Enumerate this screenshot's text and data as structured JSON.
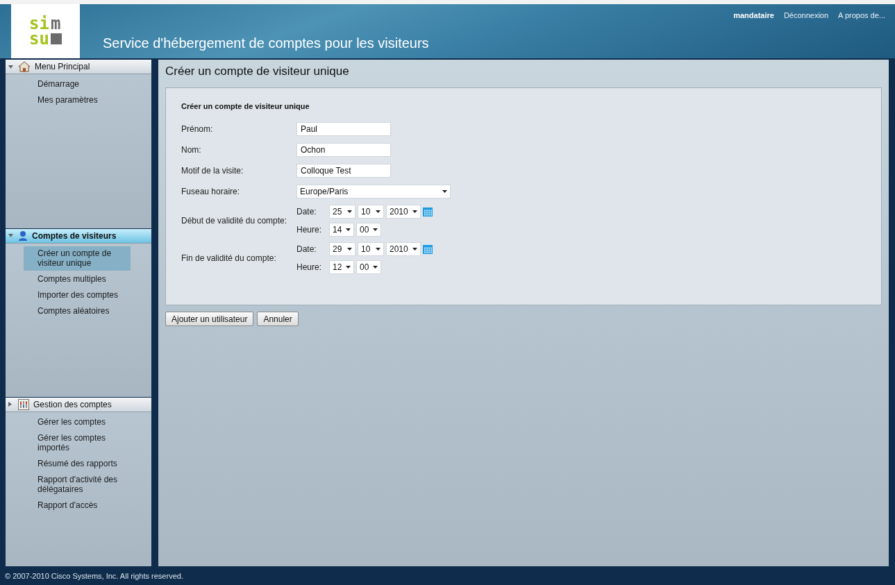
{
  "logo": {
    "parts": [
      {
        "text": "si",
        "kind": "accent"
      },
      {
        "text": "m",
        "kind": "muted"
      },
      {
        "text": "su",
        "kind": "accent"
      }
    ]
  },
  "header": {
    "title": "Service d'hébergement de comptes pour les visiteurs",
    "user": "mandataire",
    "links": [
      "Déconnexion",
      "A propos de..."
    ]
  },
  "sidebar": {
    "sections": [
      {
        "title": "Menu Principal",
        "kind": "home",
        "expanded": true,
        "selected": false,
        "items": [
          {
            "label": "Démarrage",
            "selected": false
          },
          {
            "label": "Mes paramètres",
            "selected": false
          }
        ]
      },
      {
        "title": "Comptes de visiteurs",
        "kind": "user",
        "expanded": true,
        "selected": true,
        "items": [
          {
            "label": "Créer un compte de visiteur unique",
            "selected": true
          },
          {
            "label": "Comptes multiples",
            "selected": false
          },
          {
            "label": "Importer des comptes",
            "selected": false
          },
          {
            "label": "Comptes aléatoires",
            "selected": false
          }
        ]
      },
      {
        "title": "Gestion des comptes",
        "kind": "settings",
        "expanded": false,
        "selected": false,
        "items": [
          {
            "label": "Gérer les comptes",
            "selected": false
          },
          {
            "label": "Gérer les comptes importés",
            "selected": false
          },
          {
            "label": "Résumé des rapports",
            "selected": false
          },
          {
            "label": "Rapport d'activité des délégataires",
            "selected": false
          },
          {
            "label": "Rapport d'accès",
            "selected": false
          }
        ]
      }
    ]
  },
  "page": {
    "title": "Créer un compte de visiteur unique",
    "form_title": "Créer un compte de visiteur unique",
    "fields": [
      {
        "kind": "text",
        "label": "Prénom:",
        "value": "Paul"
      },
      {
        "kind": "text",
        "label": "Nom:",
        "value": "Ochon"
      },
      {
        "kind": "text",
        "label": "Motif de la visite:",
        "value": "Colloque Test"
      },
      {
        "kind": "select",
        "label": "Fuseau horaire:",
        "value": "Europe/Paris"
      },
      {
        "kind": "datetime",
        "label": "Début de validité du compte:",
        "date_label": "Date:",
        "date": [
          "25",
          "10",
          "2010"
        ],
        "time_label": "Heure:",
        "time": [
          "14",
          "00"
        ]
      },
      {
        "kind": "datetime",
        "label": "Fin de validité du compte:",
        "date_label": "Date:",
        "date": [
          "29",
          "10",
          "2010"
        ],
        "time_label": "Heure:",
        "time": [
          "12",
          "00"
        ]
      }
    ],
    "buttons": [
      "Ajouter un utilisateur",
      "Annuler"
    ]
  },
  "footer": "© 2007-2010 Cisco Systems, Inc. All rights reserved."
}
